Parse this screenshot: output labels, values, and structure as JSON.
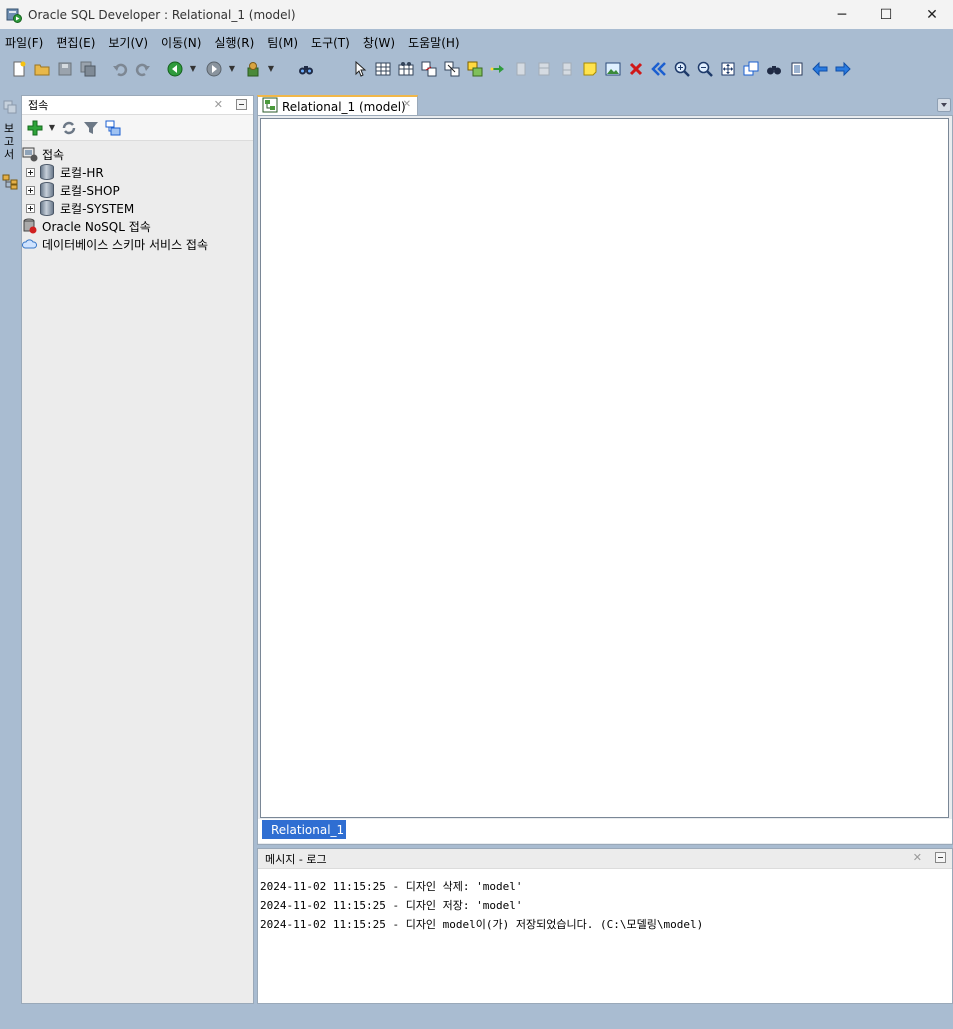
{
  "window": {
    "title": "Oracle SQL Developer : Relational_1 (model)",
    "minimize": "─",
    "maximize": "☐",
    "close": "✕"
  },
  "menu": [
    "파일(F)",
    "편집(E)",
    "보기(V)",
    "이동(N)",
    "실행(R)",
    "팀(M)",
    "도구(T)",
    "창(W)",
    "도움말(H)"
  ],
  "left_strip": {
    "vtab_label": "보고서"
  },
  "connections_panel": {
    "title": "접속",
    "tree": {
      "root": "접속",
      "children": [
        "로컬-HR",
        "로컬-SHOP",
        "로컬-SYSTEM"
      ],
      "nosql": "Oracle NoSQL 접속",
      "cloud": "데이터베이스 스키마 서비스 접속"
    }
  },
  "editor": {
    "tab_label": "Relational_1 (model)",
    "subtab_label": "Relational_1"
  },
  "message_panel": {
    "title": "메시지 - 로그",
    "lines": [
      "2024-11-02 11:15:25 - 디자인 삭제: 'model'",
      "2024-11-02 11:15:25 - 디자인 저장: 'model'",
      "2024-11-02 11:15:25 - 디자인 model이(가) 저장되었습니다. (C:\\모델링\\model)"
    ]
  },
  "icons": {
    "accent": "#f1b749",
    "selection": "#2f6ed2"
  }
}
